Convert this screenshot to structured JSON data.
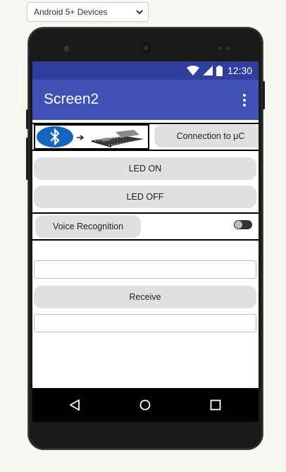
{
  "device_selector": {
    "selected": "Android 5+ Devices"
  },
  "status_bar": {
    "time": "12:30"
  },
  "app_bar": {
    "title": "Screen2"
  },
  "connection": {
    "image_label": "bluetooth-esp32-image",
    "button_label": "Connection to μC"
  },
  "buttons": {
    "led_on": "LED ON",
    "led_off": "LED OFF",
    "receive": "Receive"
  },
  "voice": {
    "button_label": "Voice Recognition",
    "switch_on": false
  },
  "fields": {
    "send_text": "",
    "received_text": ""
  },
  "colors": {
    "status_bar": "#303f9f",
    "app_bar": "#3f51b5",
    "bluetooth": "#1565c0"
  }
}
